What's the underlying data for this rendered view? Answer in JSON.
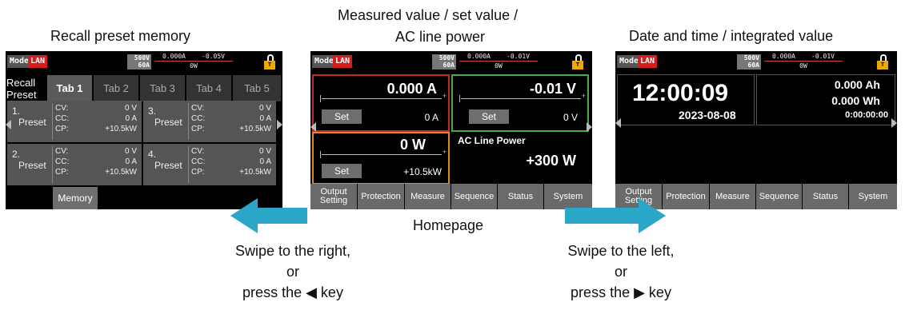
{
  "captions": {
    "recall": "Recall preset memory",
    "home_top_line1": "Measured value / set value /",
    "home_top_line2": "AC line power",
    "date": "Date and time / integrated value",
    "homepage": "Homepage",
    "left_line1": "Swipe to the right,",
    "left_line2": "or",
    "left_line3": "press the ◀ key",
    "right_line1": "Swipe to the left,",
    "right_line2": "or",
    "right_line3": "press the ▶ key"
  },
  "status": {
    "mode": "Mode",
    "lan": "LAN",
    "voltage_rating": "500V",
    "current_rating": "60A",
    "lock_label": "T",
    "left": {
      "current": "0.000A",
      "voltage": "-0.05V",
      "power": "0W"
    },
    "center": {
      "current": "0.000A",
      "voltage": "-0.01V",
      "power": "0W"
    },
    "right": {
      "current": "0.000A",
      "voltage": "-0.01V",
      "power": "0W"
    }
  },
  "recall": {
    "title_line1": "Recall",
    "title_line2": "Preset",
    "tabs": [
      "Tab 1",
      "Tab 2",
      "Tab 3",
      "Tab 4",
      "Tab 5"
    ],
    "presets": [
      {
        "num": "1.",
        "name": "Preset",
        "cv_label": "CV:",
        "cv": "0 V",
        "cc_label": "CC:",
        "cc": "0 A",
        "cp_label": "CP:",
        "cp": "+10.5kW"
      },
      {
        "num": "3.",
        "name": "Preset",
        "cv_label": "CV:",
        "cv": "0 V",
        "cc_label": "CC:",
        "cc": "0 A",
        "cp_label": "CP:",
        "cp": "+10.5kW"
      },
      {
        "num": "2.",
        "name": "Preset",
        "cv_label": "CV:",
        "cv": "0 V",
        "cc_label": "CC:",
        "cc": "0 A",
        "cp_label": "CP:",
        "cp": "+10.5kW"
      },
      {
        "num": "4.",
        "name": "Preset",
        "cv_label": "CV:",
        "cv": "0 V",
        "cc_label": "CC:",
        "cc": "0 A",
        "cp_label": "CP:",
        "cp": "+10.5kW"
      }
    ],
    "memory_button": "Memory"
  },
  "home": {
    "current_value": "0.000 A",
    "current_set": "0 A",
    "voltage_value": "-0.01 V",
    "voltage_set": "0 V",
    "power_value": "0 W",
    "power_set": "+10.5kW",
    "set_label": "Set",
    "ac_title": "AC Line Power",
    "ac_value": "+300 W",
    "border_colors": {
      "current": "#c0282a",
      "voltage": "#3fae4a",
      "power": "#e08a1e"
    }
  },
  "datetime": {
    "time": "12:00:09",
    "date": "2023-08-08",
    "ah": "0.000 Ah",
    "wh": "0.000 Wh",
    "elapsed": "0:00:00:00"
  },
  "function_tabs": {
    "output_setting_line1": "Output",
    "output_setting_line2": "Setting",
    "protection": "Protection",
    "measure": "Measure",
    "sequence": "Sequence",
    "status": "Status",
    "system": "System"
  },
  "colors": {
    "swipe_arrow": "#2aa6c8",
    "screen_bg": "#000000",
    "lan_badge": "#d41e1e"
  }
}
